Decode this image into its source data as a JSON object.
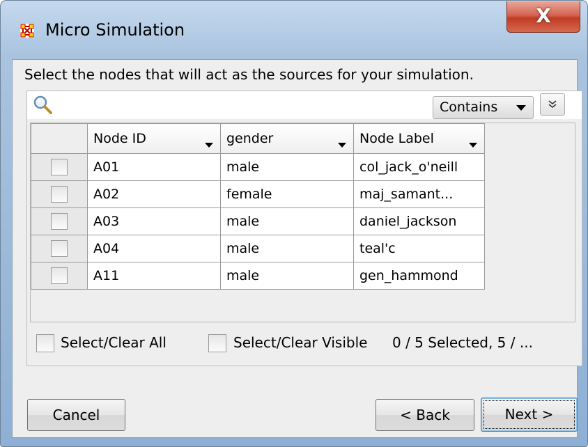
{
  "window": {
    "title": "Micro Simulation",
    "close_label": "X"
  },
  "instruction": "Select the nodes that will act as the sources for your simulation.",
  "search": {
    "value": "",
    "filter_mode": "Contains",
    "expand_glyph": "»"
  },
  "table": {
    "columns": [
      "Node ID",
      "gender",
      "Node Label"
    ],
    "rows": [
      {
        "checked": false,
        "node_id": "A01",
        "gender": "male",
        "label": "col_jack_o'neill"
      },
      {
        "checked": false,
        "node_id": "A02",
        "gender": "female",
        "label": "maj_samant..."
      },
      {
        "checked": false,
        "node_id": "A03",
        "gender": "male",
        "label": "daniel_jackson"
      },
      {
        "checked": false,
        "node_id": "A04",
        "gender": "male",
        "label": "teal'c"
      },
      {
        "checked": false,
        "node_id": "A11",
        "gender": "male",
        "label": "gen_hammond"
      }
    ]
  },
  "footer": {
    "select_all": "Select/Clear All",
    "select_visible": "Select/Clear Visible",
    "status": "0 / 5 Selected, 5 / ..."
  },
  "buttons": {
    "cancel": "Cancel",
    "back": "< Back",
    "next": "Next >"
  },
  "colors": {
    "close_red": "#c9442b",
    "frame_blue": "#a9c3df"
  },
  "icons": {
    "app": "network-nodes-icon",
    "search": "magnifier-icon"
  }
}
